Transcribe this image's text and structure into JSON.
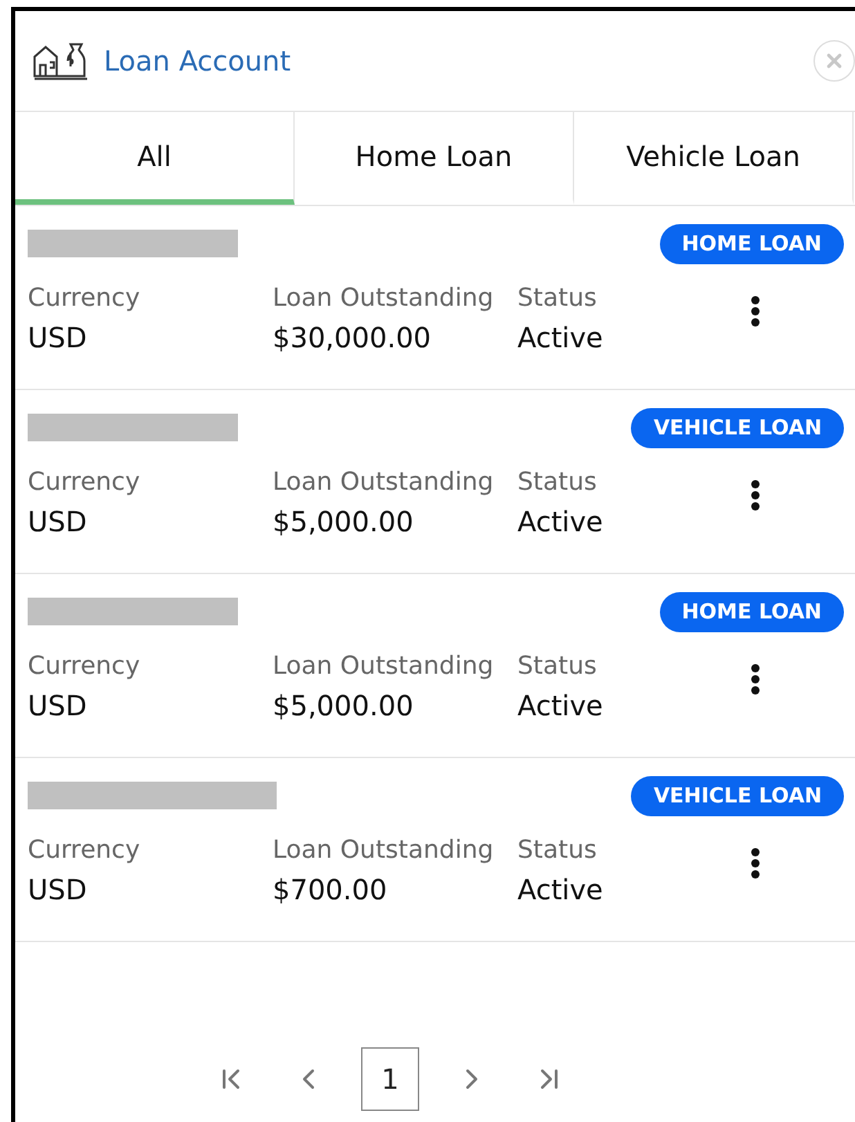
{
  "window": {
    "title": "Loan Account"
  },
  "tabs": [
    {
      "label": "All",
      "selected": true
    },
    {
      "label": "Home Loan",
      "selected": false
    },
    {
      "label": "Vehicle Loan",
      "selected": false
    }
  ],
  "accounts": [
    {
      "badge": "HOME LOAN",
      "fields": [
        {
          "label": "Currency",
          "value": "USD"
        },
        {
          "label": "Loan Outstanding",
          "value": "$30,000.00"
        },
        {
          "label": "Status",
          "value": "Active"
        }
      ]
    },
    {
      "badge": "VEHICLE LOAN",
      "fields": [
        {
          "label": "Currency",
          "value": "USD"
        },
        {
          "label": "Loan Outstanding",
          "value": "$5,000.00"
        },
        {
          "label": "Status",
          "value": "Active"
        }
      ]
    },
    {
      "badge": "HOME LOAN",
      "fields": [
        {
          "label": "Currency",
          "value": "USD"
        },
        {
          "label": "Loan Outstanding",
          "value": "$5,000.00"
        },
        {
          "label": "Status",
          "value": "Active"
        }
      ]
    },
    {
      "badge": "VEHICLE LOAN",
      "fields": [
        {
          "label": "Currency",
          "value": "USD"
        },
        {
          "label": "Loan Outstanding",
          "value": "$700.00"
        },
        {
          "label": "Status",
          "value": "Active"
        }
      ]
    }
  ],
  "pagination": {
    "pages": [
      {
        "label": "1",
        "selected": true
      }
    ]
  }
}
